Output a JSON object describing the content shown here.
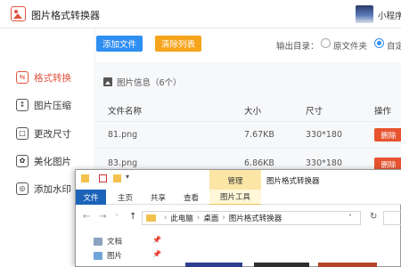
{
  "app": {
    "title": "图片格式转换器",
    "user_name": "小程序"
  },
  "sidebar": {
    "items": [
      {
        "label": "格式转换",
        "icon": "convert-icon",
        "active": true
      },
      {
        "label": "图片压缩",
        "icon": "compress-icon",
        "active": false
      },
      {
        "label": "更改尺寸",
        "icon": "resize-icon",
        "active": false
      },
      {
        "label": "美化图片",
        "icon": "beautify-icon",
        "active": false
      },
      {
        "label": "添加水印",
        "icon": "watermark-icon",
        "active": false
      }
    ]
  },
  "toolbar": {
    "add_label": "添加文件",
    "clear_label": "清除列表",
    "output_label": "输出目录：",
    "option_original": "原文件夹",
    "option_custom": "自定",
    "selected_option": "custom",
    "accent": "#2f8ef2",
    "clear_color": "#f6a41b"
  },
  "panel": {
    "heading": "图片信息（6个）"
  },
  "table": {
    "headers": [
      "文件名称",
      "大小",
      "尺寸",
      "操作"
    ],
    "rows": [
      {
        "name": "81.png",
        "size": "7.67KB",
        "dims": "330*180",
        "action": "删除"
      },
      {
        "name": "83.png",
        "size": "6.86KB",
        "dims": "330*180",
        "action": "删除"
      }
    ],
    "delete_color": "#e8532f"
  },
  "explorer": {
    "manage_tab": "管理",
    "window_title": "图片格式转换器",
    "tabs": {
      "file": "文件",
      "home": "主页",
      "share": "共享",
      "view": "查看",
      "picture_tools": "图片工具"
    },
    "breadcrumb": [
      "此电脑",
      "桌面",
      "图片格式转换器"
    ],
    "nav_items": [
      "文档",
      "图片"
    ]
  }
}
